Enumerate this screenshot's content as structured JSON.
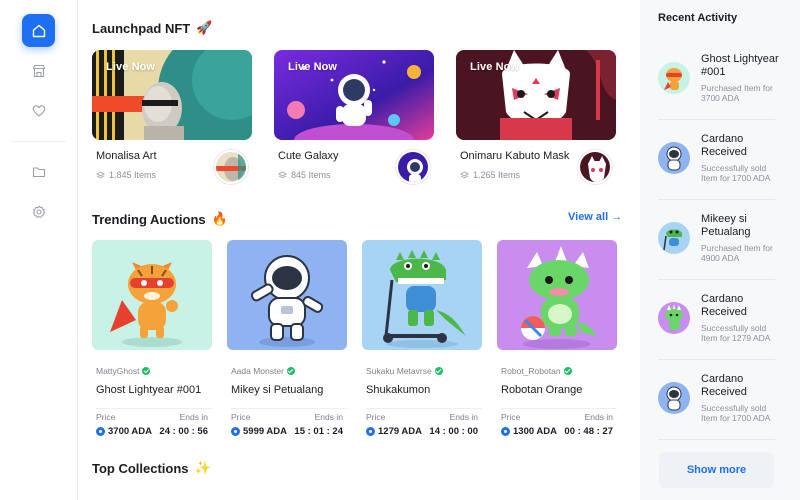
{
  "sidebar": {
    "items": [
      {
        "icon": "home-icon",
        "active": true
      },
      {
        "icon": "store-icon",
        "active": false
      },
      {
        "icon": "heart-icon",
        "active": false
      },
      {
        "icon": "folder-icon",
        "active": false
      },
      {
        "icon": "gear-icon",
        "active": false
      }
    ]
  },
  "launchpad": {
    "title": "Launchpad NFT",
    "emoji": "🚀",
    "cards": [
      {
        "badge": "Live Now",
        "name": "Monalisa Art",
        "items": "1.845 Items"
      },
      {
        "badge": "Live Now",
        "name": "Cute Galaxy",
        "items": "845 Items"
      },
      {
        "badge": "Live Now",
        "name": "Onimaru Kabuto Mask",
        "items": "1.265 Items"
      }
    ]
  },
  "trending": {
    "title": "Trending Auctions",
    "emoji": "🔥",
    "view_all": "View all →",
    "price_label": "Price",
    "ends_label": "Ends in",
    "cards": [
      {
        "creator": "MattyGhost",
        "name": "Ghost Lightyear #001",
        "price": "3700 ADA",
        "ends": "24 : 00 : 56"
      },
      {
        "creator": "Aada Monster",
        "name": "Mikey si Petualang",
        "price": "5999 ADA",
        "ends": "15 : 01 : 24"
      },
      {
        "creator": "Sukaku Metavrse",
        "name": "Shukakumon",
        "price": "1279 ADA",
        "ends": "14 : 00 : 00"
      },
      {
        "creator": "Robot_Robotan",
        "name": "Robotan Orange",
        "price": "1300 ADA",
        "ends": "00 : 48 : 27"
      }
    ]
  },
  "collections": {
    "title": "Top Collections",
    "emoji": "✨"
  },
  "activity": {
    "title": "Recent Activity",
    "items": [
      {
        "title": "Ghost Lightyear #001",
        "desc": "Purchased Item for 3700 ADA"
      },
      {
        "title": "Cardano Received",
        "desc": "Successfully sold Item for 1700 ADA"
      },
      {
        "title": "Mikeey si Petualang",
        "desc": "Purchased Item for 4900 ADA"
      },
      {
        "title": "Cardano Received",
        "desc": "Successfully sold Item for 1279 ADA"
      },
      {
        "title": "Cardano Received",
        "desc": "Successfully sold Item for 1700 ADA"
      }
    ],
    "show_more": "Show more"
  },
  "colors": {
    "accent": "#1f6ff2",
    "verified": "#1fbf6a",
    "panel_bg": "#f7f8fa"
  }
}
